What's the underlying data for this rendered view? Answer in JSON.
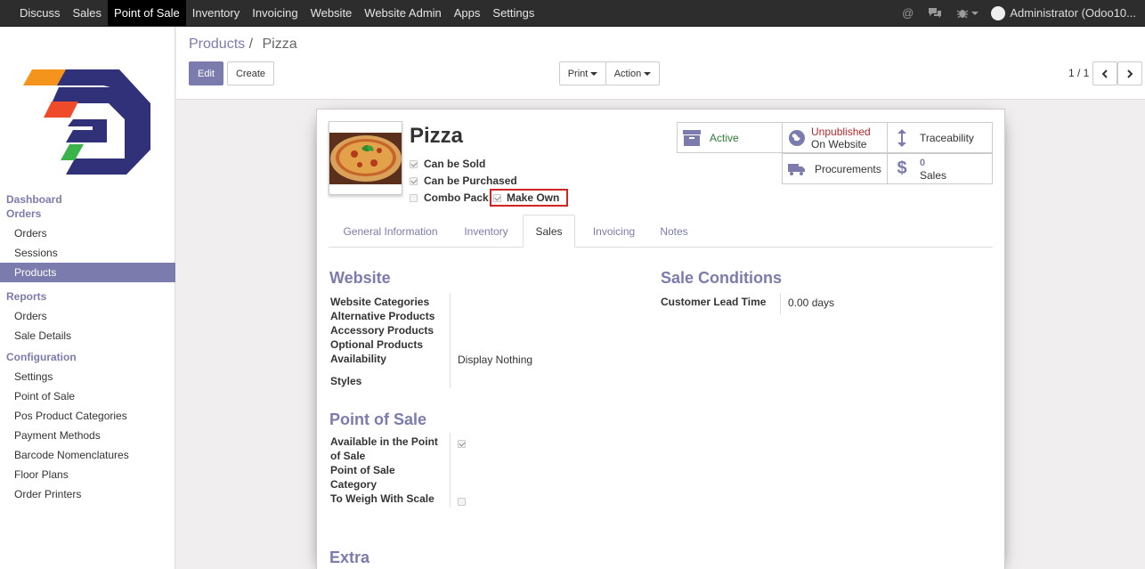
{
  "topnav": {
    "items": [
      "Discuss",
      "Sales",
      "Point of Sale",
      "Inventory",
      "Invoicing",
      "Website",
      "Website Admin",
      "Apps",
      "Settings"
    ],
    "active": "Point of Sale",
    "user": "Administrator (Odoo10..."
  },
  "sidebar": {
    "dashboard": "Dashboard",
    "orders_header": "Orders",
    "orders_items": [
      "Orders",
      "Sessions",
      "Products"
    ],
    "reports_header": "Reports",
    "reports_items": [
      "Orders",
      "Sale Details"
    ],
    "config_header": "Configuration",
    "config_items": [
      "Settings",
      "Point of Sale",
      "Pos Product Categories",
      "Payment Methods",
      "Barcode Nomenclatures",
      "Floor Plans",
      "Order Printers"
    ],
    "selected": "Products"
  },
  "control": {
    "breadcrumb_parent": "Products",
    "breadcrumb_sep": "/",
    "breadcrumb_current": "Pizza",
    "edit": "Edit",
    "create": "Create",
    "print": "Print",
    "action": "Action",
    "pager": "1 / 1"
  },
  "product": {
    "name": "Pizza",
    "can_be_sold": "Can be Sold",
    "can_be_purchased": "Can be Purchased",
    "combo_pack": "Combo Pack",
    "make_own": "Make Own"
  },
  "stats": {
    "active": "Active",
    "unpublished": "Unpublished",
    "on_website": "On Website",
    "traceability": "Traceability",
    "procurements": "Procurements",
    "sales_count": "0",
    "sales": "Sales"
  },
  "tabs": [
    "General Information",
    "Inventory",
    "Sales",
    "Invoicing",
    "Notes"
  ],
  "active_tab": "Sales",
  "website": {
    "title": "Website",
    "website_categories": "Website Categories",
    "alternative_products": "Alternative Products",
    "accessory_products": "Accessory Products",
    "optional_products": "Optional Products",
    "availability": "Availability",
    "availability_value": "Display Nothing",
    "styles": "Styles"
  },
  "sale_conditions": {
    "title": "Sale Conditions",
    "lead_time_label": "Customer Lead Time",
    "lead_time_value": "0.00 days"
  },
  "pos": {
    "title": "Point of Sale",
    "available_l1": "Available in the Point",
    "available_l2": "of Sale",
    "category_l1": "Point of Sale",
    "category_l2": "Category",
    "weigh": "To Weigh With Scale"
  },
  "extra": {
    "title": "Extra"
  },
  "colors": {
    "accent": "#7c7bad",
    "navbar": "#2d2d2d",
    "highlight_border": "#d32323",
    "unpublished": "#b52b2b",
    "active_green": "#2e7d32"
  }
}
